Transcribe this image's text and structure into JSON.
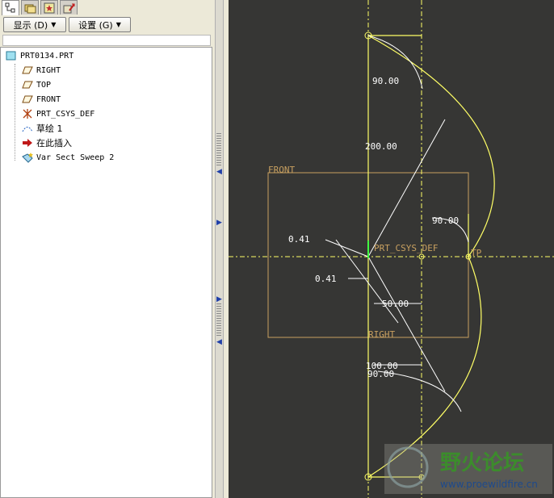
{
  "toolbar": {
    "show_label": "显示 (D)",
    "settings_label": "设置 (G)"
  },
  "tree": {
    "items": [
      {
        "label": "PRT0134.PRT",
        "icon": "part-icon"
      },
      {
        "label": "RIGHT",
        "icon": "datum-plane-icon"
      },
      {
        "label": "TOP",
        "icon": "datum-plane-icon"
      },
      {
        "label": "FRONT",
        "icon": "datum-plane-icon"
      },
      {
        "label": "PRT_CSYS_DEF",
        "icon": "coordinate-system-icon"
      },
      {
        "label": "草绘 1",
        "icon": "sketch-icon"
      },
      {
        "label": "在此插入",
        "icon": "insert-here-arrow-icon"
      },
      {
        "label": "Var Sect Sweep 2",
        "icon": "variable-section-sweep-icon"
      }
    ]
  },
  "canvas": {
    "background": "#363634",
    "datum_color": "#c8a060",
    "sketch_color": "#ffff66",
    "dimension_color": "#ffffff",
    "labels": {
      "front": "FRONT",
      "right": "RIGHT",
      "csys": "PRT_CSYS_DEF",
      "tp": "TP"
    },
    "dimensions": {
      "d_top_angle": "90.00",
      "d_height": "200.00",
      "d_mid_angle": "90.00",
      "d_left_a": "0.41",
      "d_left_b": "0.41",
      "d_offset": "50.00",
      "d_bottom": "100.00",
      "d_bottom_angle": "90.00"
    }
  },
  "watermark": {
    "title": "野火论坛",
    "url": "www.proewildfire.cn"
  }
}
